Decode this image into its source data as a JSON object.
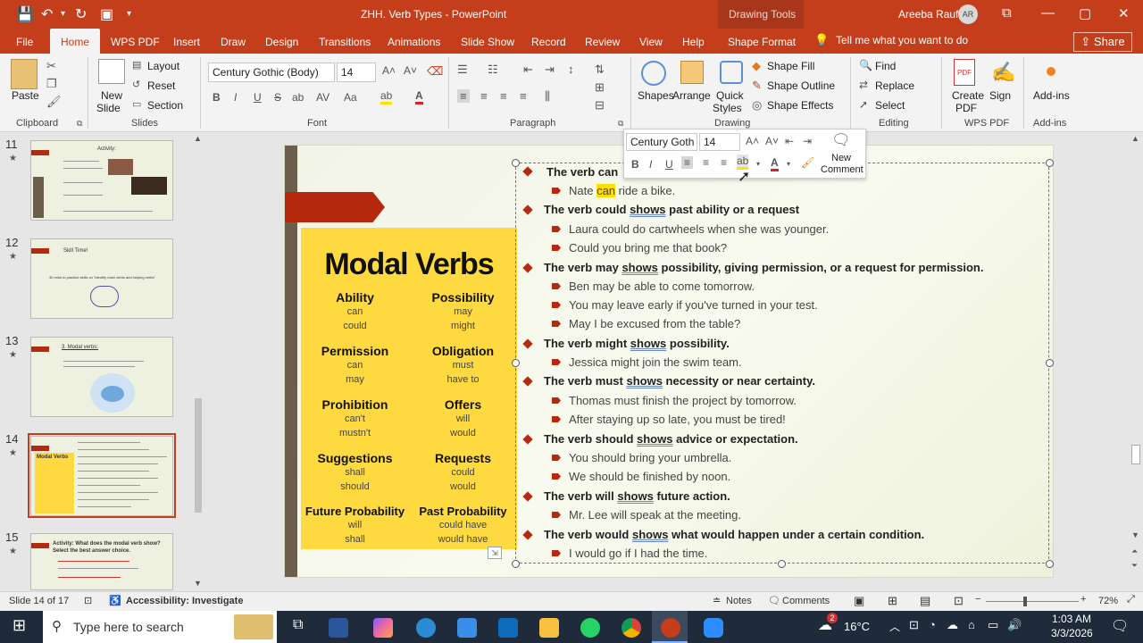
{
  "titlebar": {
    "doc_title": "ZHH. Verb Types  -  PowerPoint",
    "drawing_tools": "Drawing Tools",
    "user_name": "Areeba Rauf",
    "user_initials": "AR"
  },
  "tabs": [
    "File",
    "Home",
    "WPS PDF",
    "Insert",
    "Draw",
    "Design",
    "Transitions",
    "Animations",
    "Slide Show",
    "Record",
    "Review",
    "View",
    "Help",
    "Shape Format"
  ],
  "tell_me": "Tell me what you want to do",
  "share": "Share",
  "ribbon": {
    "clipboard": {
      "paste": "Paste",
      "label": "Clipboard"
    },
    "slides": {
      "new_slide_1": "New",
      "new_slide_2": "Slide",
      "layout": "Layout",
      "reset": "Reset",
      "section": "Section",
      "label": "Slides"
    },
    "font": {
      "name": "Century Gothic (Body)",
      "size": "14",
      "label": "Font"
    },
    "paragraph": {
      "label": "Paragraph"
    },
    "drawing": {
      "shapes": "Shapes",
      "arrange": "Arrange",
      "quick_styles_1": "Quick",
      "quick_styles_2": "Styles",
      "shape_fill": "Shape Fill",
      "shape_outline": "Shape Outline",
      "shape_effects": "Shape Effects",
      "label": "Drawing"
    },
    "editing": {
      "find": "Find",
      "replace": "Replace",
      "select": "Select",
      "label": "Editing"
    },
    "wps": {
      "create_1": "Create",
      "create_2": "PDF",
      "sign": "Sign",
      "label": "WPS PDF"
    },
    "addins": {
      "addins": "Add-ins",
      "label": "Add-ins"
    }
  },
  "thumbnails": [
    {
      "num": "11",
      "title": "Activity:"
    },
    {
      "num": "12",
      "title": "Skill Time!"
    },
    {
      "num": "13",
      "title": "3. Modal verbs:"
    },
    {
      "num": "14",
      "title": "Modal Verbs"
    },
    {
      "num": "15",
      "title": "Activity: What does the modal verb show?"
    }
  ],
  "thumb_extra": {
    "t12_body": "30 mins to practice skills on \"identify main verbs and helping verbs\"",
    "t15_sub": "Select the best answer choice."
  },
  "slide": {
    "poster_title": "Modal Verbs",
    "categories": [
      {
        "head": "Ability",
        "words": [
          "can",
          "could"
        ]
      },
      {
        "head": "Possibility",
        "words": [
          "may",
          "might"
        ]
      },
      {
        "head": "Permission",
        "words": [
          "can",
          "may"
        ]
      },
      {
        "head": "Obligation",
        "words": [
          "must",
          "have to"
        ]
      },
      {
        "head": "Prohibition",
        "words": [
          "can't",
          "mustn't"
        ]
      },
      {
        "head": "Offers",
        "words": [
          "will",
          "would"
        ]
      },
      {
        "head": "Suggestions",
        "words": [
          "shall",
          "should"
        ]
      },
      {
        "head": "Requests",
        "words": [
          "could",
          "would"
        ]
      },
      {
        "head": "Future Probability",
        "words": [
          "will",
          "shall"
        ]
      },
      {
        "head": "Past Probability",
        "words": [
          "could have",
          "would have"
        ]
      }
    ],
    "lines": {
      "l01a": "The verb can",
      "l02a": "Nate ",
      "l02b": "can",
      "l02c": " ride a bike.",
      "l03a": "The verb could ",
      "l03b": "shows",
      "l03c": " past ability or a request",
      "l04": "Laura could do cartwheels when she was younger.",
      "l05": "Could you bring me that book?",
      "l06a": "The verb may ",
      "l06b": "shows",
      "l06c": " possibility, giving permission, or a request for permission.",
      "l07": "Ben may be able to come tomorrow.",
      "l08": "You may leave early if you've turned in your test.",
      "l09": "May I be excused from the table?",
      "l10a": "The verb might ",
      "l10b": "shows",
      "l10c": " possibility.",
      "l11": "Jessica might join the swim team.",
      "l12a": "The verb must ",
      "l12b": "shows",
      "l12c": " necessity or near certainty.",
      "l13": "Thomas must finish the project by tomorrow.",
      "l14": "After staying up so late, you must be tired!",
      "l15a": "The verb should ",
      "l15b": "shows",
      "l15c": " advice or expectation.",
      "l16": "You should bring your umbrella.",
      "l17": "We should be finished by noon.",
      "l18a": "The verb will ",
      "l18b": "shows",
      "l18c": " future action.",
      "l19": "Mr. Lee will speak at the meeting.",
      "l20a": "The verb would ",
      "l20b": "shows",
      "l20c": " what would happen under a certain condition.",
      "l21": "I would go if I had the time."
    }
  },
  "mini_toolbar": {
    "font": "Century Goth",
    "size": "14",
    "new_comment_1": "New",
    "new_comment_2": "Comment"
  },
  "status": {
    "slide_info": "Slide 14 of 17",
    "accessibility": "Accessibility: Investigate",
    "notes": "Notes",
    "comments": "Comments",
    "zoom": "72%"
  },
  "taskbar": {
    "search": "Type here to search",
    "weather": "16°C",
    "time": "1:03 AM",
    "date": "3/3/2026",
    "badge": "2"
  }
}
